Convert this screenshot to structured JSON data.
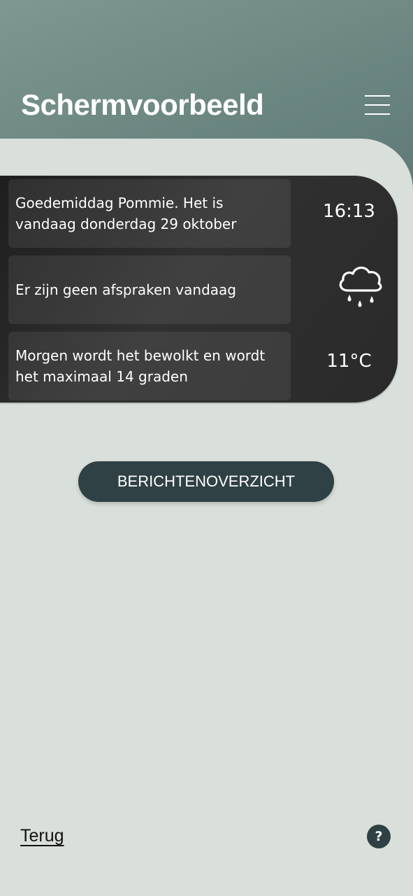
{
  "header": {
    "title": "Schermvoorbeeld",
    "menu_icon": "hamburger-menu-icon"
  },
  "info_card": {
    "greeting": "Goedemiddag Pommie. Het is vandaag donderdag 29 oktober",
    "time": "16:13",
    "appointments": "Er zijn geen afspraken vandaag",
    "weather_icon": "rain-cloud-icon",
    "forecast": "Morgen wordt het bewolkt en wordt het maximaal 14 graden",
    "temperature": "11°C"
  },
  "actions": {
    "messages_button": "BERICHTENOVERZICHT"
  },
  "footer": {
    "back_link": "Terug",
    "help_label": "?"
  },
  "colors": {
    "header_bg": "#6b8680",
    "page_bg": "#d9dfda",
    "card_bg": "#2a2a2a",
    "button_bg": "#2f4144"
  }
}
